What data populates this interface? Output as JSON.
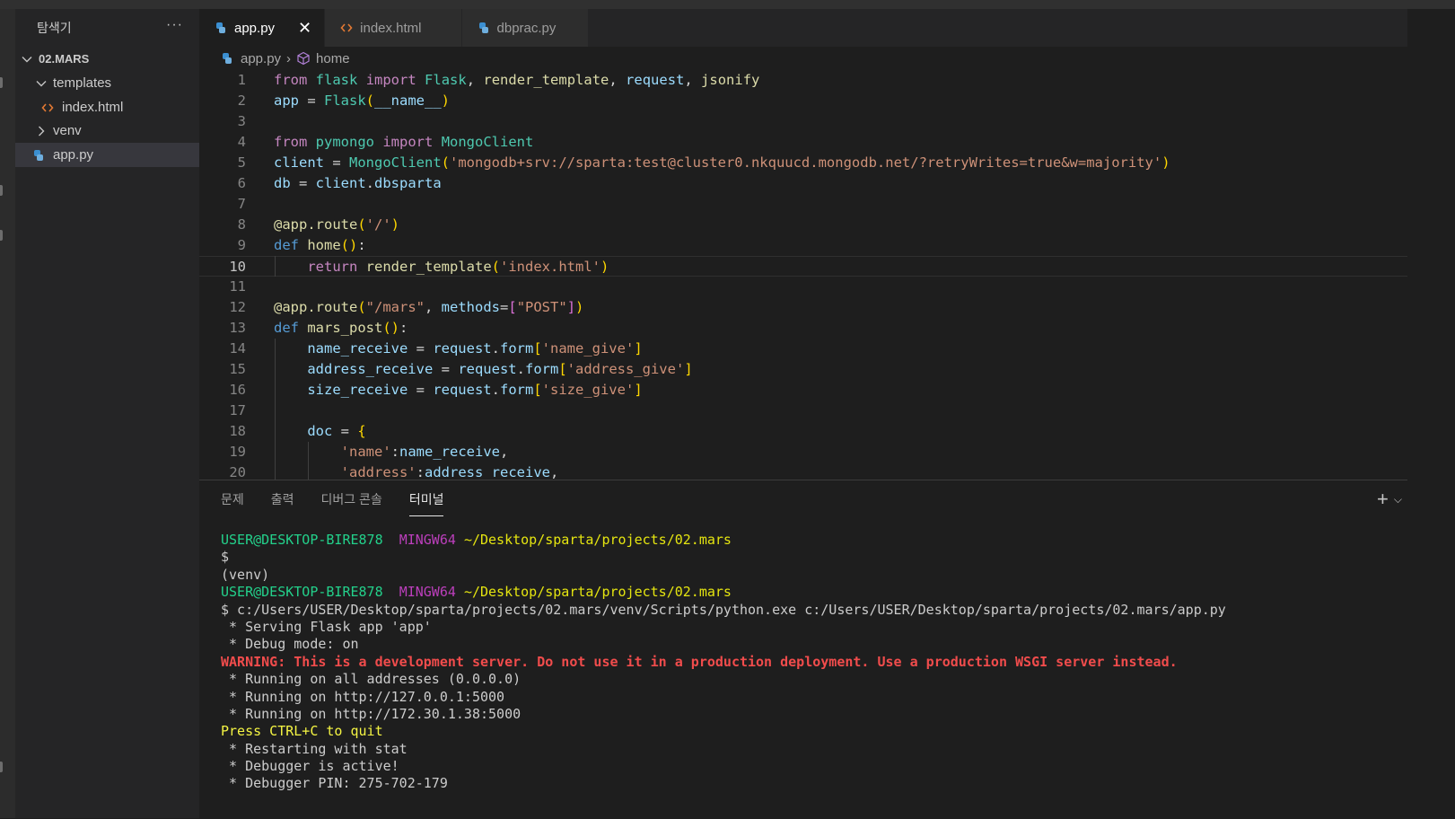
{
  "explorer": {
    "title": "탐색기",
    "more": "···",
    "root": "02.MARS",
    "items": [
      {
        "label": "templates",
        "kind": "folder-open"
      },
      {
        "label": "index.html",
        "kind": "html"
      },
      {
        "label": "venv",
        "kind": "folder-closed"
      },
      {
        "label": "app.py",
        "kind": "python",
        "selected": true
      }
    ]
  },
  "tabs": [
    {
      "label": "app.py",
      "icon": "python-icon",
      "active": true,
      "close": "✕"
    },
    {
      "label": "index.html",
      "icon": "html-icon",
      "active": false
    },
    {
      "label": "dbprac.py",
      "icon": "python-icon",
      "active": false
    }
  ],
  "breadcrumb": {
    "file": "app.py",
    "sep": "›",
    "symbol": "home"
  },
  "editor": {
    "current_line": 10,
    "lines": [
      {
        "n": "1",
        "t": [
          [
            "kw2",
            "from"
          ],
          [
            "p",
            " "
          ],
          [
            "cls",
            "flask"
          ],
          [
            "p",
            " "
          ],
          [
            "kw2",
            "import"
          ],
          [
            "p",
            " "
          ],
          [
            "cls",
            "Flask"
          ],
          [
            "p",
            ", "
          ],
          [
            "fn",
            "render_template"
          ],
          [
            "p",
            ", "
          ],
          [
            "var",
            "request"
          ],
          [
            "p",
            ", "
          ],
          [
            "fn",
            "jsonify"
          ]
        ]
      },
      {
        "n": "2",
        "t": [
          [
            "var",
            "app"
          ],
          [
            "p",
            " = "
          ],
          [
            "cls",
            "Flask"
          ],
          [
            "br1",
            "("
          ],
          [
            "var",
            "__name__"
          ],
          [
            "br1",
            ")"
          ]
        ]
      },
      {
        "n": "3",
        "t": []
      },
      {
        "n": "4",
        "t": [
          [
            "kw2",
            "from"
          ],
          [
            "p",
            " "
          ],
          [
            "cls",
            "pymongo"
          ],
          [
            "p",
            " "
          ],
          [
            "kw2",
            "import"
          ],
          [
            "p",
            " "
          ],
          [
            "cls",
            "MongoClient"
          ]
        ]
      },
      {
        "n": "5",
        "t": [
          [
            "var",
            "client"
          ],
          [
            "p",
            " = "
          ],
          [
            "cls",
            "MongoClient"
          ],
          [
            "br1",
            "("
          ],
          [
            "str",
            "'mongodb+srv://sparta:test@cluster0.nkquucd.mongodb.net/?retryWrites=true&w=majority'"
          ],
          [
            "br1",
            ")"
          ]
        ]
      },
      {
        "n": "6",
        "t": [
          [
            "var",
            "db"
          ],
          [
            "p",
            " = "
          ],
          [
            "var",
            "client"
          ],
          [
            "p",
            "."
          ],
          [
            "var",
            "dbsparta"
          ]
        ]
      },
      {
        "n": "7",
        "t": []
      },
      {
        "n": "8",
        "t": [
          [
            "dec",
            "@app.route"
          ],
          [
            "br1",
            "("
          ],
          [
            "str",
            "'/'"
          ],
          [
            "br1",
            ")"
          ]
        ]
      },
      {
        "n": "9",
        "t": [
          [
            "kw",
            "def"
          ],
          [
            "p",
            " "
          ],
          [
            "fn",
            "home"
          ],
          [
            "br1",
            "()"
          ],
          [
            "p",
            ":"
          ]
        ]
      },
      {
        "n": "10",
        "t": [
          [
            "p",
            "    "
          ],
          [
            "kw2",
            "return"
          ],
          [
            "p",
            " "
          ],
          [
            "fn",
            "render_template"
          ],
          [
            "br1",
            "("
          ],
          [
            "str",
            "'index.html'"
          ],
          [
            "br1",
            ")"
          ]
        ]
      },
      {
        "n": "11",
        "t": []
      },
      {
        "n": "12",
        "t": [
          [
            "dec",
            "@app.route"
          ],
          [
            "br1",
            "("
          ],
          [
            "str",
            "\"/mars\""
          ],
          [
            "p",
            ", "
          ],
          [
            "var",
            "methods"
          ],
          [
            "p",
            "="
          ],
          [
            "br2",
            "["
          ],
          [
            "str",
            "\"POST\""
          ],
          [
            "br2",
            "]"
          ],
          [
            "br1",
            ")"
          ]
        ]
      },
      {
        "n": "13",
        "t": [
          [
            "kw",
            "def"
          ],
          [
            "p",
            " "
          ],
          [
            "fn",
            "mars_post"
          ],
          [
            "br1",
            "()"
          ],
          [
            "p",
            ":"
          ]
        ]
      },
      {
        "n": "14",
        "t": [
          [
            "p",
            "    "
          ],
          [
            "var",
            "name_receive"
          ],
          [
            "p",
            " = "
          ],
          [
            "var",
            "request"
          ],
          [
            "p",
            "."
          ],
          [
            "var",
            "form"
          ],
          [
            "br1",
            "["
          ],
          [
            "str",
            "'name_give'"
          ],
          [
            "br1",
            "]"
          ]
        ]
      },
      {
        "n": "15",
        "t": [
          [
            "p",
            "    "
          ],
          [
            "var",
            "address_receive"
          ],
          [
            "p",
            " = "
          ],
          [
            "var",
            "request"
          ],
          [
            "p",
            "."
          ],
          [
            "var",
            "form"
          ],
          [
            "br1",
            "["
          ],
          [
            "str",
            "'address_give'"
          ],
          [
            "br1",
            "]"
          ]
        ]
      },
      {
        "n": "16",
        "t": [
          [
            "p",
            "    "
          ],
          [
            "var",
            "size_receive"
          ],
          [
            "p",
            " = "
          ],
          [
            "var",
            "request"
          ],
          [
            "p",
            "."
          ],
          [
            "var",
            "form"
          ],
          [
            "br1",
            "["
          ],
          [
            "str",
            "'size_give'"
          ],
          [
            "br1",
            "]"
          ]
        ]
      },
      {
        "n": "17",
        "t": []
      },
      {
        "n": "18",
        "t": [
          [
            "p",
            "    "
          ],
          [
            "var",
            "doc"
          ],
          [
            "p",
            " = "
          ],
          [
            "br1",
            "{"
          ]
        ]
      },
      {
        "n": "19",
        "t": [
          [
            "p",
            "        "
          ],
          [
            "str",
            "'name'"
          ],
          [
            "p",
            ":"
          ],
          [
            "var",
            "name_receive"
          ],
          [
            "p",
            ","
          ]
        ]
      },
      {
        "n": "20",
        "t": [
          [
            "p",
            "        "
          ],
          [
            "str",
            "'address'"
          ],
          [
            "p",
            ":"
          ],
          [
            "var",
            "address_receive"
          ],
          [
            "p",
            ","
          ]
        ]
      }
    ]
  },
  "panel": {
    "tabs": [
      {
        "label": "문제",
        "active": false
      },
      {
        "label": "출력",
        "active": false
      },
      {
        "label": "디버그 콘솔",
        "active": false
      },
      {
        "label": "터미널",
        "active": true
      }
    ],
    "add": "+",
    "dropdown": "⌵"
  },
  "terminal": {
    "lines": [
      [
        [
          "t-green",
          "USER@DESKTOP-BIRE878"
        ],
        [
          "",
          "  "
        ],
        [
          "t-mag",
          "MINGW64"
        ],
        [
          "",
          " "
        ],
        [
          "t-yel",
          "~/Desktop/sparta/projects/02.mars"
        ]
      ],
      [
        [
          "",
          "$"
        ]
      ],
      [
        [
          "",
          "(venv)"
        ]
      ],
      [
        [
          "t-green",
          "USER@DESKTOP-BIRE878"
        ],
        [
          "",
          "  "
        ],
        [
          "t-mag",
          "MINGW64"
        ],
        [
          "",
          " "
        ],
        [
          "t-yel",
          "~/Desktop/sparta/projects/02.mars"
        ]
      ],
      [
        [
          "",
          "$ c:/Users/USER/Desktop/sparta/projects/02.mars/venv/Scripts/python.exe c:/Users/USER/Desktop/sparta/projects/02.mars/app.py"
        ]
      ],
      [
        [
          "",
          " * Serving Flask app 'app'"
        ]
      ],
      [
        [
          "",
          " * Debug mode: on"
        ]
      ],
      [
        [
          "t-red",
          "WARNING: This is a development server. Do not use it in a production deployment. Use a production WSGI server instead."
        ]
      ],
      [
        [
          "",
          " * Running on all addresses (0.0.0.0)"
        ]
      ],
      [
        [
          "",
          " * Running on http://127.0.0.1:5000"
        ]
      ],
      [
        [
          "",
          " * Running on http://172.30.1.38:5000"
        ]
      ],
      [
        [
          "t-yel2",
          "Press CTRL+C to quit"
        ]
      ],
      [
        [
          "",
          " * Restarting with stat"
        ]
      ],
      [
        [
          "",
          " * Debugger is active!"
        ]
      ],
      [
        [
          "",
          " * Debugger PIN: 275-702-179"
        ]
      ]
    ]
  }
}
